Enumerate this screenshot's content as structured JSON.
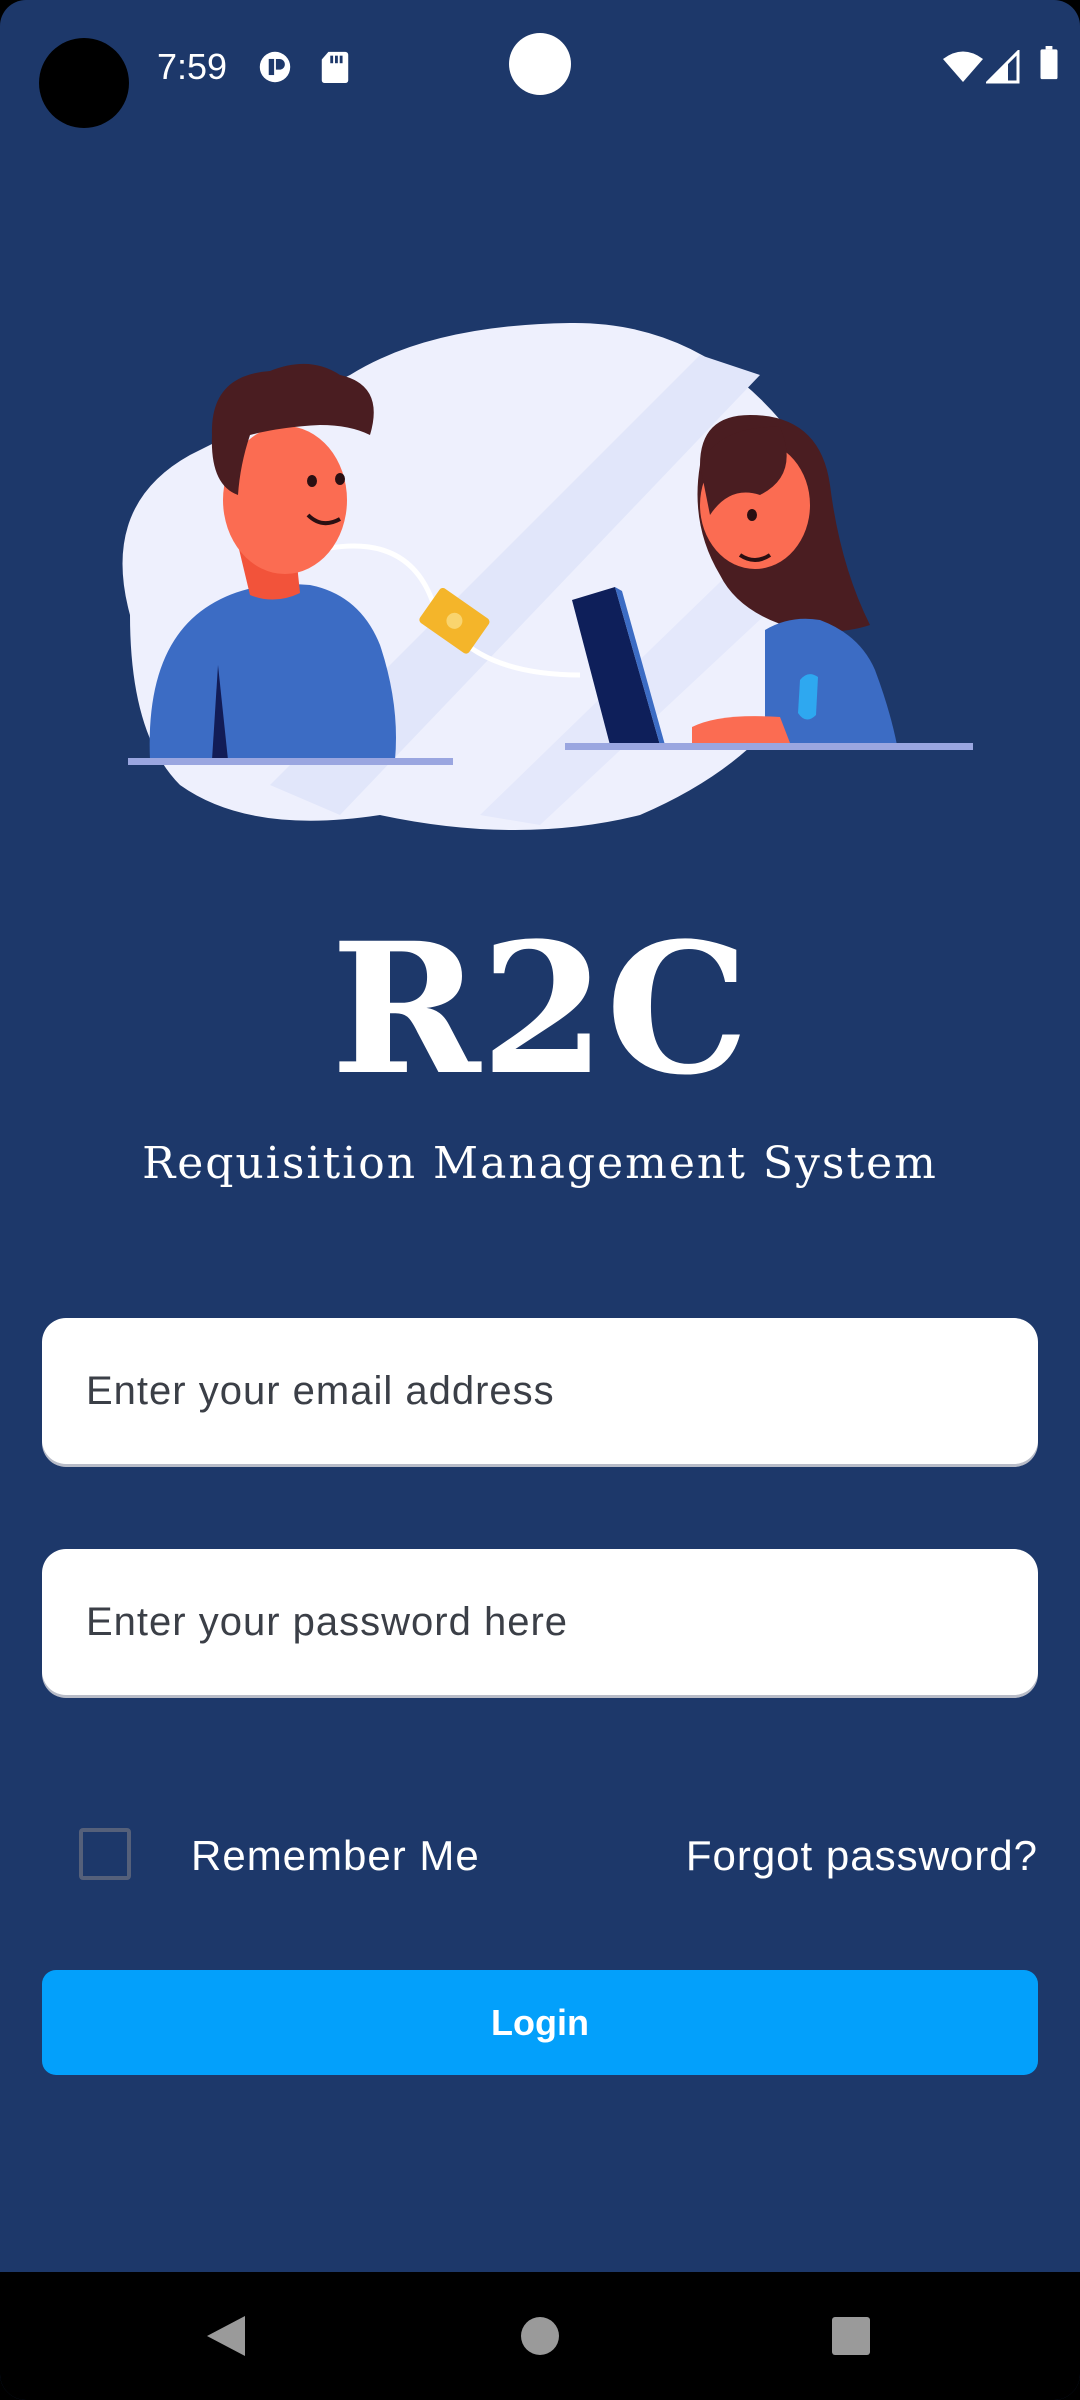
{
  "status_bar": {
    "time": "7:59",
    "icons": [
      "notification-icon",
      "sd-card-icon",
      "wifi-icon",
      "cellular-signal-icon",
      "battery-icon"
    ]
  },
  "brand": {
    "title": "R2C",
    "subtitle": "Requisition Management System"
  },
  "form": {
    "email_placeholder": "Enter your email address",
    "password_placeholder": "Enter your password here",
    "remember_label": "Remember Me",
    "remember_checked": false,
    "forgot_label": "Forgot password?",
    "login_label": "Login"
  },
  "colors": {
    "background": "#1d386a",
    "accent": "#03a0fb",
    "field_bg": "#ffffff"
  },
  "nav_bar": {
    "buttons": [
      "back-icon",
      "home-icon",
      "recents-icon"
    ]
  }
}
